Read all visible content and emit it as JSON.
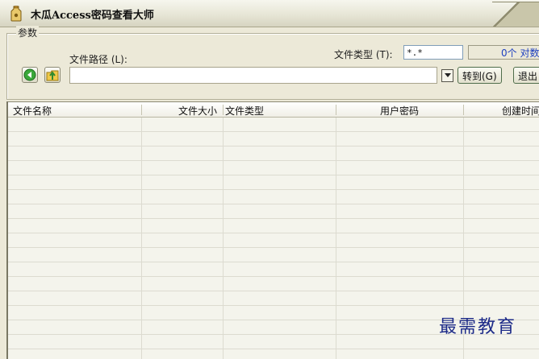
{
  "window": {
    "title": "木瓜Access密码查看大师",
    "app_icon": "key-bottle-icon"
  },
  "params": {
    "group_title": "参数",
    "file_path_label": "文件路径 (L):",
    "file_type_label": "文件类型 (T):",
    "file_type_value": "*.*",
    "count_text": "0个 对数",
    "back_icon": "back-arrow-icon",
    "up_icon": "up-folder-icon",
    "dropdown_icon": "chevron-down-icon",
    "goto_label": "转到(G)",
    "exit_label": "退出"
  },
  "table": {
    "columns": [
      "文件名称",
      "文件大小",
      "文件类型",
      "用户密码",
      "创建时间"
    ]
  },
  "watermark": "最需教育",
  "colors": {
    "background": "#ece9d8",
    "accent_blue": "#1e40c0",
    "table_bg": "#f4f4ec"
  }
}
